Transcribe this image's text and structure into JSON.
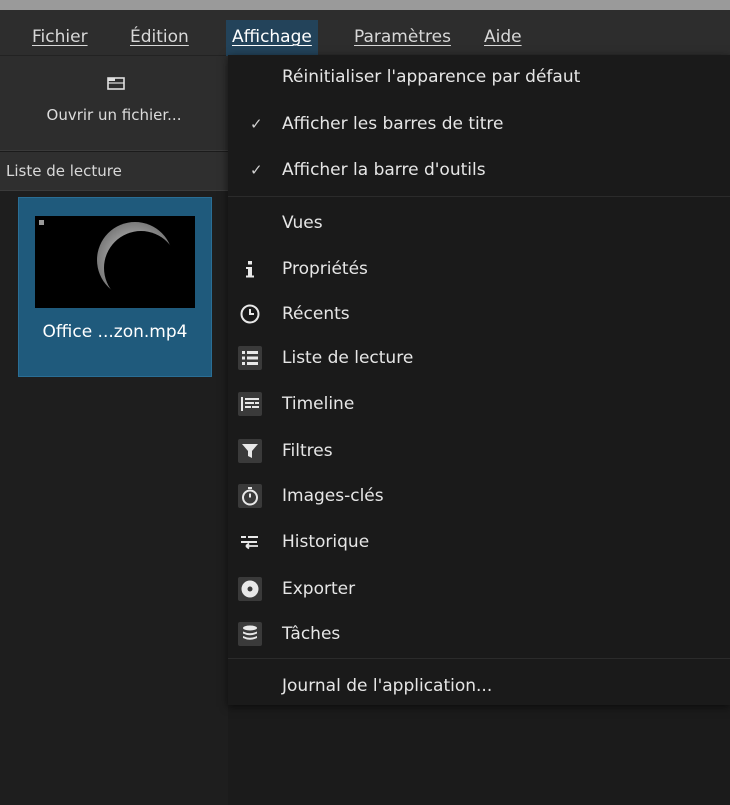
{
  "menubar": {
    "items": [
      {
        "label": "Fichier"
      },
      {
        "label": "Édition"
      },
      {
        "label": "Affichage",
        "active": true
      },
      {
        "label": "Paramètres"
      },
      {
        "label": "Aide"
      }
    ]
  },
  "toolbar": {
    "open_button_label": "Ouvrir un fichier...",
    "open_icon": "folder-icon"
  },
  "playlist": {
    "title": "Liste de lecture",
    "clips": [
      {
        "label": "Office ...zon.mp4"
      }
    ]
  },
  "view_menu": {
    "items": [
      {
        "label": "Réinitialiser l'apparence par défaut"
      },
      {
        "label": "Afficher les barres de titre",
        "checked": true,
        "check": "✓"
      },
      {
        "label": "Afficher la barre d'outils",
        "checked": true,
        "check": "✓"
      },
      {
        "label": "Vues"
      },
      {
        "label": "Propriétés",
        "icon": "info-icon"
      },
      {
        "label": "Récents",
        "icon": "clock-icon"
      },
      {
        "label": "Liste de lecture",
        "icon": "list-icon"
      },
      {
        "label": "Timeline",
        "icon": "timeline-icon"
      },
      {
        "label": "Filtres",
        "icon": "filter-icon"
      },
      {
        "label": "Images-clés",
        "icon": "stopwatch-icon"
      },
      {
        "label": "Historique",
        "icon": "history-icon"
      },
      {
        "label": "Exporter",
        "icon": "disc-icon"
      },
      {
        "label": "Tâches",
        "icon": "database-icon"
      },
      {
        "label": "Journal de l'application..."
      }
    ]
  },
  "colors": {
    "accent": "#23435a",
    "selection": "#1f5a7c",
    "background": "#1b1b1b",
    "menu_background": "#1a1a1a"
  }
}
